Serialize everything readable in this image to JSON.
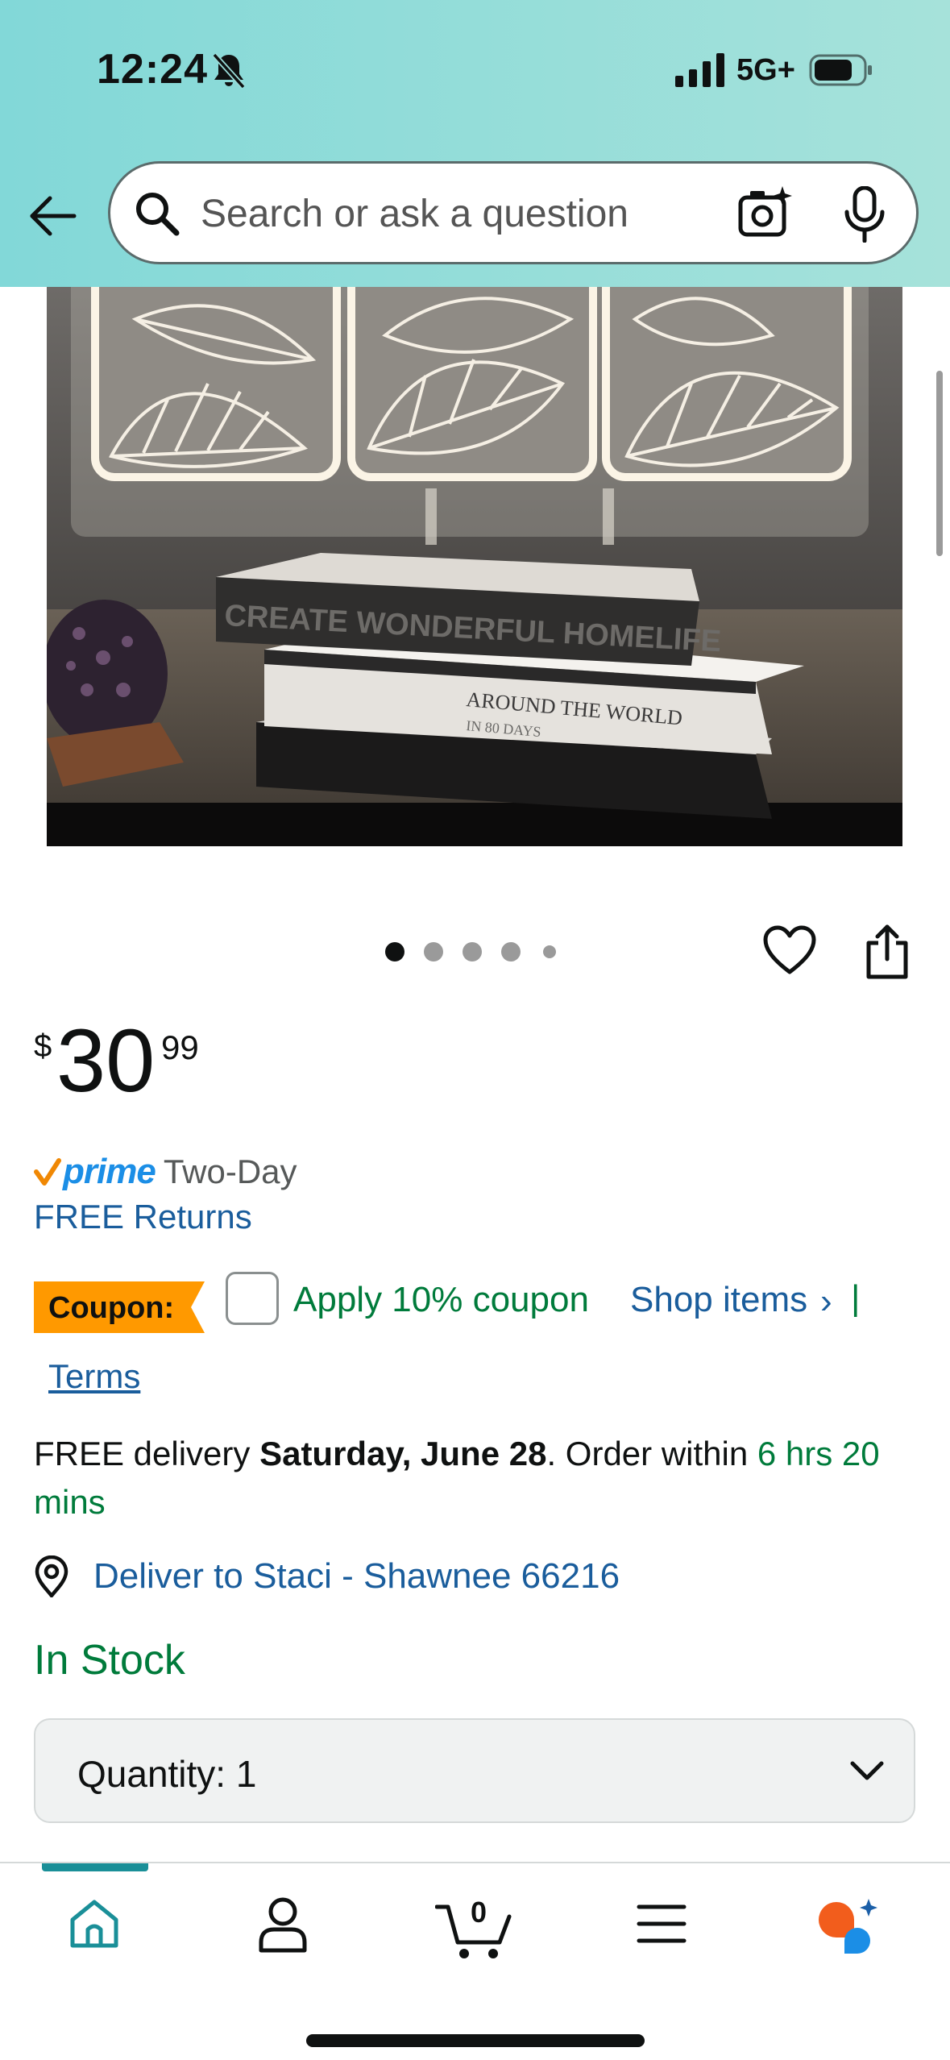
{
  "status_bar": {
    "time": "12:24",
    "network": "5G+",
    "icons": [
      "bell-slash-icon",
      "signal-icon",
      "battery-icon"
    ]
  },
  "header": {
    "search_placeholder": "Search or ask a question",
    "icons": [
      "back-arrow-icon",
      "search-icon",
      "camera-icon",
      "microphone-icon"
    ],
    "gradient": [
      "#82d8d8",
      "#a6e2da"
    ]
  },
  "product_image": {
    "book_spine_1": "CREATE WONDERFUL HOMELIFE",
    "book_spine_2": "AROUND THE WORLD",
    "book_spine_2_sub": "IN 80 DAYS"
  },
  "carousel": {
    "total": 5,
    "active_index": 0
  },
  "price": {
    "currency": "$",
    "whole": "30",
    "fraction": "99"
  },
  "prime": {
    "badge": "prime",
    "shipping": "Two-Day",
    "returns": "FREE Returns"
  },
  "coupon": {
    "badge": "Coupon:",
    "apply_label": "Apply 10% coupon",
    "shop_items": "Shop items",
    "chevron": "›",
    "separator": "|",
    "terms": "Terms",
    "checked": false
  },
  "delivery": {
    "prefix": "FREE delivery ",
    "date": "Saturday, June 28",
    "mid": ". Order within ",
    "countdown": "6 hrs 20 mins"
  },
  "location": {
    "label": "Deliver to Staci - Shawnee 66216"
  },
  "stock": {
    "status": "In Stock"
  },
  "quantity": {
    "label": "Quantity:",
    "value": "1"
  },
  "bottom_nav": {
    "items": [
      "home",
      "account",
      "cart",
      "menu",
      "rufus"
    ],
    "cart_count": "0",
    "active": "home",
    "accent": "#1a8f98"
  },
  "colors": {
    "link": "#1a5d9c",
    "green": "#007b3b",
    "prime_blue": "#1b8ee6",
    "coupon_orange": "#ff9900"
  }
}
